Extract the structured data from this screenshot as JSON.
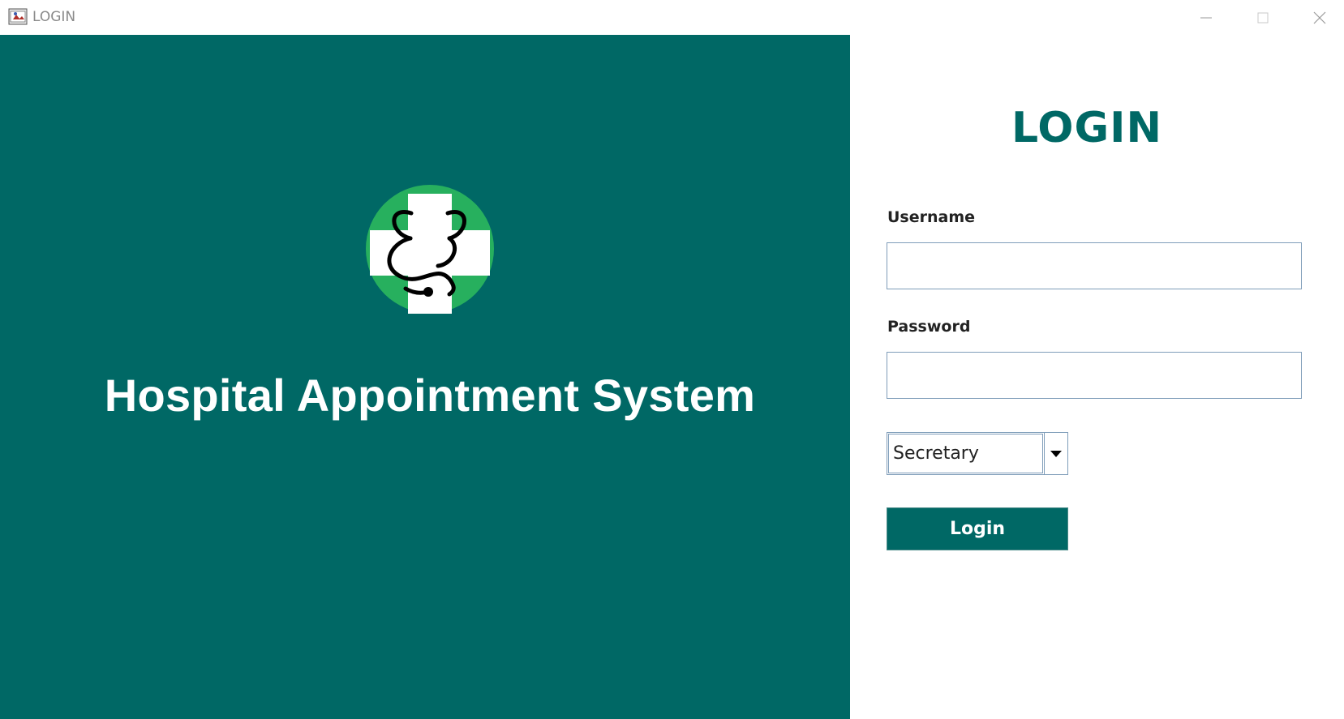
{
  "window": {
    "title": "LOGIN",
    "controls": [
      "minimize-icon",
      "maximize-icon",
      "close-icon"
    ]
  },
  "brand": {
    "app_name": "Hospital Appointment System",
    "logo_icon": "medical-cross-stethoscope-icon"
  },
  "login": {
    "heading": "LOGIN",
    "username_label": "Username",
    "username_value": "",
    "password_label": "Password",
    "password_value": "",
    "role_selected": "Secretary",
    "submit_label": "Login"
  },
  "colors": {
    "primary": "#006865",
    "logo_green": "#27b05e",
    "white": "#ffffff"
  }
}
